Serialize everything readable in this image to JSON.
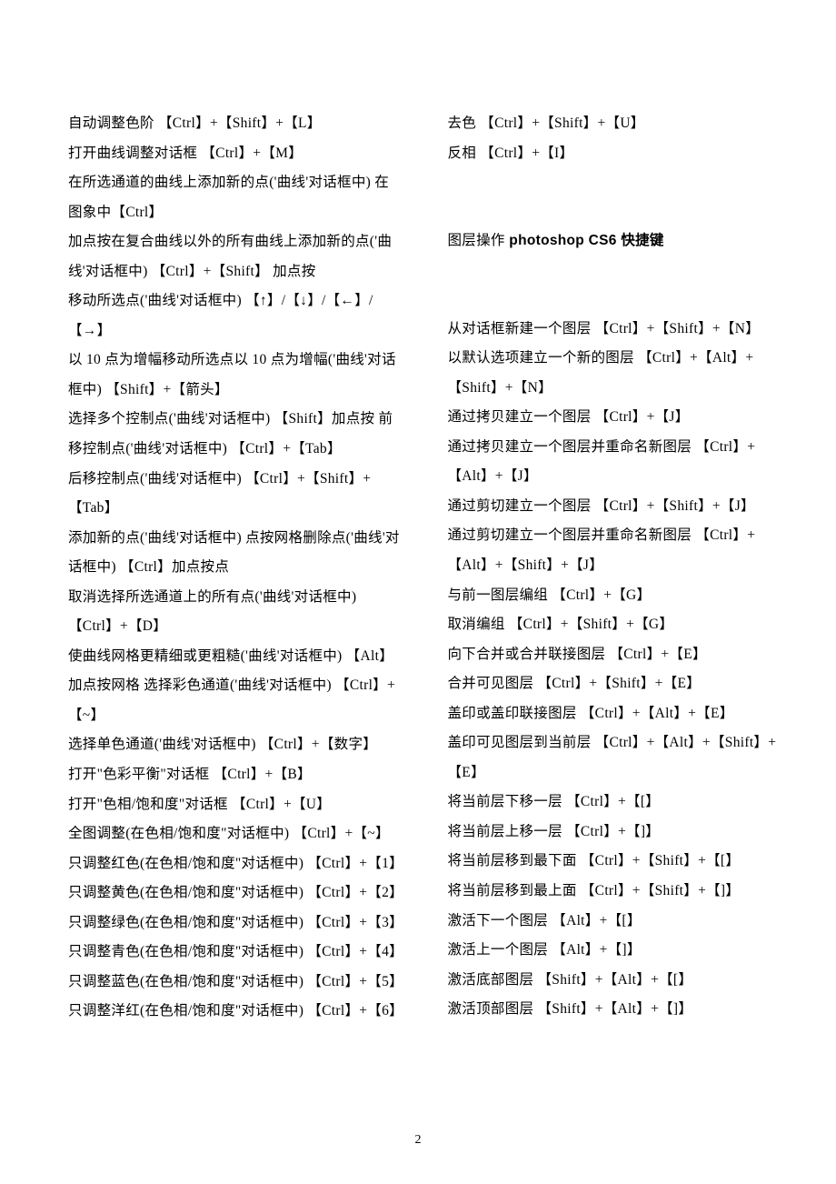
{
  "leftColumn": [
    "自动调整色阶 【Ctrl】+【Shift】+【L】",
    "打开曲线调整对话框 【Ctrl】+【M】",
    "在所选通道的曲线上添加新的点('曲线'对话框中)  在图象中【Ctrl】",
    "加点按在复合曲线以外的所有曲线上添加新的点('曲线'对话框中) 【Ctrl】+【Shift】  加点按",
    "移动所选点('曲线'对话框中) 【↑】/【↓】/【←】/【→】",
    "以 10 点为增幅移动所选点以 10 点为增幅('曲线'对话框中) 【Shift】+【箭头】",
    "选择多个控制点('曲线'对话框中) 【Shift】加点按  前移控制点('曲线'对话框中) 【Ctrl】+【Tab】",
    "后移控制点('曲线'对话框中) 【Ctrl】+【Shift】+【Tab】",
    "添加新的点('曲线'对话框中) 点按网格删除点('曲线'对话框中) 【Ctrl】加点按点",
    "取消选择所选通道上的所有点('曲线'对话框中) 【Ctrl】+【D】",
    "使曲线网格更精细或更粗糙('曲线'对话框中) 【Alt】加点按网格  选择彩色通道('曲线'对话框中) 【Ctrl】+【~】",
    "选择单色通道('曲线'对话框中) 【Ctrl】+【数字】",
    "打开\"色彩平衡\"对话框 【Ctrl】+【B】",
    "打开\"色相/饱和度\"对话框 【Ctrl】+【U】",
    "全图调整(在色相/饱和度\"对话框中) 【Ctrl】+【~】",
    "只调整红色(在色相/饱和度\"对话框中) 【Ctrl】+【1】",
    "只调整黄色(在色相/饱和度\"对话框中) 【Ctrl】+【2】",
    "只调整绿色(在色相/饱和度\"对话框中) 【Ctrl】+【3】",
    "只调整青色(在色相/饱和度\"对话框中) 【Ctrl】+【4】",
    "只调整蓝色(在色相/饱和度\"对话框中) 【Ctrl】+【5】",
    "只调整洋红(在色相/饱和度\"对话框中) 【Ctrl】+【6】"
  ],
  "rightColumn": {
    "topLines": [
      "去色 【Ctrl】+【Shift】+【U】",
      "反相 【Ctrl】+【I】"
    ],
    "heading": {
      "prefix": "图层操作",
      "bold": " photoshop  CS6 快捷键"
    },
    "bodyLines": [
      "从对话框新建一个图层 【Ctrl】+【Shift】+【N】",
      "以默认选项建立一个新的图层 【Ctrl】+【Alt】+【Shift】+【N】",
      "通过拷贝建立一个图层 【Ctrl】+【J】",
      "通过拷贝建立一个图层并重命名新图层 【Ctrl】+【Alt】+【J】",
      "通过剪切建立一个图层 【Ctrl】+【Shift】+【J】",
      "通过剪切建立一个图层并重命名新图层 【Ctrl】+【Alt】+【Shift】+【J】",
      "与前一图层编组 【Ctrl】+【G】",
      "取消编组 【Ctrl】+【Shift】+【G】",
      "向下合并或合并联接图层 【Ctrl】+【E】",
      "合并可见图层 【Ctrl】+【Shift】+【E】",
      "盖印或盖印联接图层 【Ctrl】+【Alt】+【E】",
      "盖印可见图层到当前层 【Ctrl】+【Alt】+【Shift】+【E】",
      "将当前层下移一层 【Ctrl】+【[】",
      "将当前层上移一层 【Ctrl】+【]】",
      "将当前层移到最下面 【Ctrl】+【Shift】+【[】",
      "将当前层移到最上面 【Ctrl】+【Shift】+【]】",
      "激活下一个图层 【Alt】+【[】",
      "激活上一个图层 【Alt】+【]】",
      "激活底部图层 【Shift】+【Alt】+【[】",
      "激活顶部图层 【Shift】+【Alt】+【]】"
    ]
  },
  "pageNumber": "2"
}
